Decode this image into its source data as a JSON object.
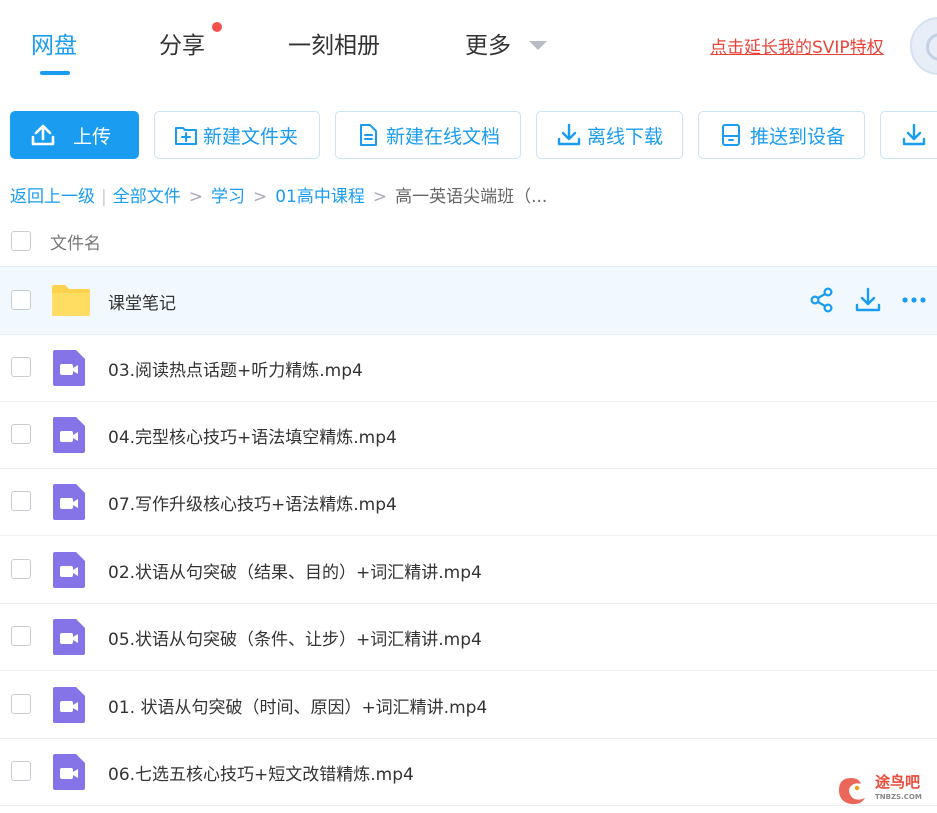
{
  "nav": {
    "tabs": [
      {
        "label": "网盘"
      },
      {
        "label": "分享"
      },
      {
        "label": "一刻相册"
      },
      {
        "label": "更多"
      }
    ],
    "svip_link": "点击延长我的SVIP特权"
  },
  "toolbar": {
    "upload": "上传",
    "new_folder": "新建文件夹",
    "new_doc": "新建在线文档",
    "offline_download": "离线下载",
    "push_device": "推送到设备"
  },
  "breadcrumb": {
    "back": "返回上一级",
    "all_files": "全部文件",
    "level1": "学习",
    "level2": "01高中课程",
    "current": "高一英语尖端班（..."
  },
  "list": {
    "header_name": "文件名",
    "rows": [
      {
        "name": "课堂笔记",
        "type": "folder"
      },
      {
        "name": "03.阅读热点话题+听力精炼.mp4",
        "type": "video"
      },
      {
        "name": "04.完型核心技巧+语法填空精炼.mp4",
        "type": "video"
      },
      {
        "name": "07.写作升级核心技巧+语法精炼.mp4",
        "type": "video"
      },
      {
        "name": "02.状语从句突破（结果、目的）+词汇精讲.mp4",
        "type": "video"
      },
      {
        "name": "05.状语从句突破（条件、让步）+词汇精讲.mp4",
        "type": "video"
      },
      {
        "name": "01. 状语从句突破（时间、原因）+词汇精讲.mp4",
        "type": "video"
      },
      {
        "name": "06.七选五核心技巧+短文改错精炼.mp4",
        "type": "video"
      }
    ]
  },
  "watermark": {
    "text": "途鸟吧",
    "sub": "TNBZS.COM"
  },
  "colors": {
    "accent": "#1a9cf0",
    "video_icon": "#8574e8",
    "folder": "#ffd24d",
    "svip": "#e8443a"
  }
}
